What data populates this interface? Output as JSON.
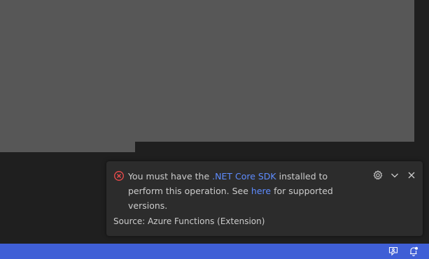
{
  "notification": {
    "severity_icon": "error-icon",
    "message_before_link": "You must have the ",
    "link1_text": ".NET Core SDK",
    "message_middle": " installed to perform this operation. See ",
    "link2_text": "here",
    "message_after_link": " for supported versions.",
    "source": "Source: Azure Functions (Extension)",
    "actions": [
      "gear-icon",
      "chevron-down-icon",
      "close-icon"
    ]
  },
  "statusbar": {
    "items": [
      "feedback-icon",
      "notifications-bell-icon"
    ]
  },
  "colors": {
    "error": "#f14c4c",
    "link": "#5e8cff",
    "statusbar": "#3f5fd6",
    "toast_bg": "#2c2c2c",
    "editor_gray": "#575757"
  }
}
